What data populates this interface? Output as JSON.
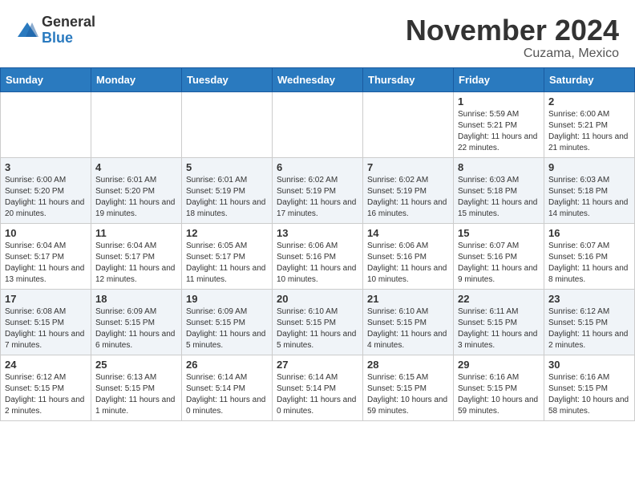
{
  "header": {
    "logo_general": "General",
    "logo_blue": "Blue",
    "month_title": "November 2024",
    "location": "Cuzama, Mexico"
  },
  "days_of_week": [
    "Sunday",
    "Monday",
    "Tuesday",
    "Wednesday",
    "Thursday",
    "Friday",
    "Saturday"
  ],
  "weeks": [
    [
      {
        "day": "",
        "info": ""
      },
      {
        "day": "",
        "info": ""
      },
      {
        "day": "",
        "info": ""
      },
      {
        "day": "",
        "info": ""
      },
      {
        "day": "",
        "info": ""
      },
      {
        "day": "1",
        "info": "Sunrise: 5:59 AM\nSunset: 5:21 PM\nDaylight: 11 hours and 22 minutes."
      },
      {
        "day": "2",
        "info": "Sunrise: 6:00 AM\nSunset: 5:21 PM\nDaylight: 11 hours and 21 minutes."
      }
    ],
    [
      {
        "day": "3",
        "info": "Sunrise: 6:00 AM\nSunset: 5:20 PM\nDaylight: 11 hours and 20 minutes."
      },
      {
        "day": "4",
        "info": "Sunrise: 6:01 AM\nSunset: 5:20 PM\nDaylight: 11 hours and 19 minutes."
      },
      {
        "day": "5",
        "info": "Sunrise: 6:01 AM\nSunset: 5:19 PM\nDaylight: 11 hours and 18 minutes."
      },
      {
        "day": "6",
        "info": "Sunrise: 6:02 AM\nSunset: 5:19 PM\nDaylight: 11 hours and 17 minutes."
      },
      {
        "day": "7",
        "info": "Sunrise: 6:02 AM\nSunset: 5:19 PM\nDaylight: 11 hours and 16 minutes."
      },
      {
        "day": "8",
        "info": "Sunrise: 6:03 AM\nSunset: 5:18 PM\nDaylight: 11 hours and 15 minutes."
      },
      {
        "day": "9",
        "info": "Sunrise: 6:03 AM\nSunset: 5:18 PM\nDaylight: 11 hours and 14 minutes."
      }
    ],
    [
      {
        "day": "10",
        "info": "Sunrise: 6:04 AM\nSunset: 5:17 PM\nDaylight: 11 hours and 13 minutes."
      },
      {
        "day": "11",
        "info": "Sunrise: 6:04 AM\nSunset: 5:17 PM\nDaylight: 11 hours and 12 minutes."
      },
      {
        "day": "12",
        "info": "Sunrise: 6:05 AM\nSunset: 5:17 PM\nDaylight: 11 hours and 11 minutes."
      },
      {
        "day": "13",
        "info": "Sunrise: 6:06 AM\nSunset: 5:16 PM\nDaylight: 11 hours and 10 minutes."
      },
      {
        "day": "14",
        "info": "Sunrise: 6:06 AM\nSunset: 5:16 PM\nDaylight: 11 hours and 10 minutes."
      },
      {
        "day": "15",
        "info": "Sunrise: 6:07 AM\nSunset: 5:16 PM\nDaylight: 11 hours and 9 minutes."
      },
      {
        "day": "16",
        "info": "Sunrise: 6:07 AM\nSunset: 5:16 PM\nDaylight: 11 hours and 8 minutes."
      }
    ],
    [
      {
        "day": "17",
        "info": "Sunrise: 6:08 AM\nSunset: 5:15 PM\nDaylight: 11 hours and 7 minutes."
      },
      {
        "day": "18",
        "info": "Sunrise: 6:09 AM\nSunset: 5:15 PM\nDaylight: 11 hours and 6 minutes."
      },
      {
        "day": "19",
        "info": "Sunrise: 6:09 AM\nSunset: 5:15 PM\nDaylight: 11 hours and 5 minutes."
      },
      {
        "day": "20",
        "info": "Sunrise: 6:10 AM\nSunset: 5:15 PM\nDaylight: 11 hours and 5 minutes."
      },
      {
        "day": "21",
        "info": "Sunrise: 6:10 AM\nSunset: 5:15 PM\nDaylight: 11 hours and 4 minutes."
      },
      {
        "day": "22",
        "info": "Sunrise: 6:11 AM\nSunset: 5:15 PM\nDaylight: 11 hours and 3 minutes."
      },
      {
        "day": "23",
        "info": "Sunrise: 6:12 AM\nSunset: 5:15 PM\nDaylight: 11 hours and 2 minutes."
      }
    ],
    [
      {
        "day": "24",
        "info": "Sunrise: 6:12 AM\nSunset: 5:15 PM\nDaylight: 11 hours and 2 minutes."
      },
      {
        "day": "25",
        "info": "Sunrise: 6:13 AM\nSunset: 5:15 PM\nDaylight: 11 hours and 1 minute."
      },
      {
        "day": "26",
        "info": "Sunrise: 6:14 AM\nSunset: 5:14 PM\nDaylight: 11 hours and 0 minutes."
      },
      {
        "day": "27",
        "info": "Sunrise: 6:14 AM\nSunset: 5:14 PM\nDaylight: 11 hours and 0 minutes."
      },
      {
        "day": "28",
        "info": "Sunrise: 6:15 AM\nSunset: 5:15 PM\nDaylight: 10 hours and 59 minutes."
      },
      {
        "day": "29",
        "info": "Sunrise: 6:16 AM\nSunset: 5:15 PM\nDaylight: 10 hours and 59 minutes."
      },
      {
        "day": "30",
        "info": "Sunrise: 6:16 AM\nSunset: 5:15 PM\nDaylight: 10 hours and 58 minutes."
      }
    ]
  ]
}
